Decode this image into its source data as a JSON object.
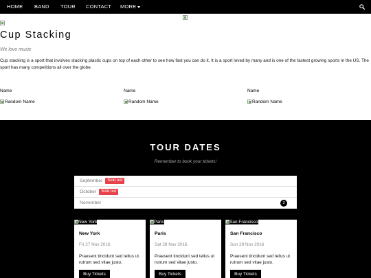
{
  "nav": {
    "items": [
      "HOME",
      "BAND",
      "TOUR",
      "CONTACT",
      "MORE"
    ]
  },
  "intro": {
    "title": "Cup Stacking",
    "tagline": "We love music",
    "description": "Cup stacking is a sport that involves stacking plastic cups on top of each other to see how fast you can do it. It is a sport loved by many and is one of the fastest growing sports in the US. The sport has many competitions all over the globe."
  },
  "members": [
    {
      "name": "Name",
      "image_alt": "Random Name"
    },
    {
      "name": "Name",
      "image_alt": "Random Name"
    },
    {
      "name": "Name",
      "image_alt": "Random Name"
    }
  ],
  "tour": {
    "title": "TOUR DATES",
    "subtitle": "Remember to book your tickets!",
    "months": [
      {
        "label": "September",
        "badge": "Sold out"
      },
      {
        "label": "October",
        "badge": "Sold out"
      },
      {
        "label": "November",
        "count": "3"
      }
    ],
    "cities": [
      {
        "image_alt": "New York",
        "name": "New York",
        "date": "Fri 27 Nov 2016",
        "text": "Praesent tincidunt sed tellus ut rutrum sed vitae justo.",
        "button": "Buy Tickets"
      },
      {
        "image_alt": "Paris",
        "name": "Paris",
        "date": "Sat 28 Nov 2016",
        "text": "Praesent tincidunt sed tellus ut rutrum sed vitae justo.",
        "button": "Buy Tickets"
      },
      {
        "image_alt": "San Francisco",
        "name": "San Francisco",
        "date": "Sun 29 Nov 2016",
        "text": "Praesent tincidunt sed tellus ut rutrum sed vitae justo.",
        "button": "Buy Tickets"
      }
    ]
  },
  "colors": {
    "nav_bg": "#000000",
    "sold_out": "#e8414a",
    "section_bg": "#000000"
  }
}
